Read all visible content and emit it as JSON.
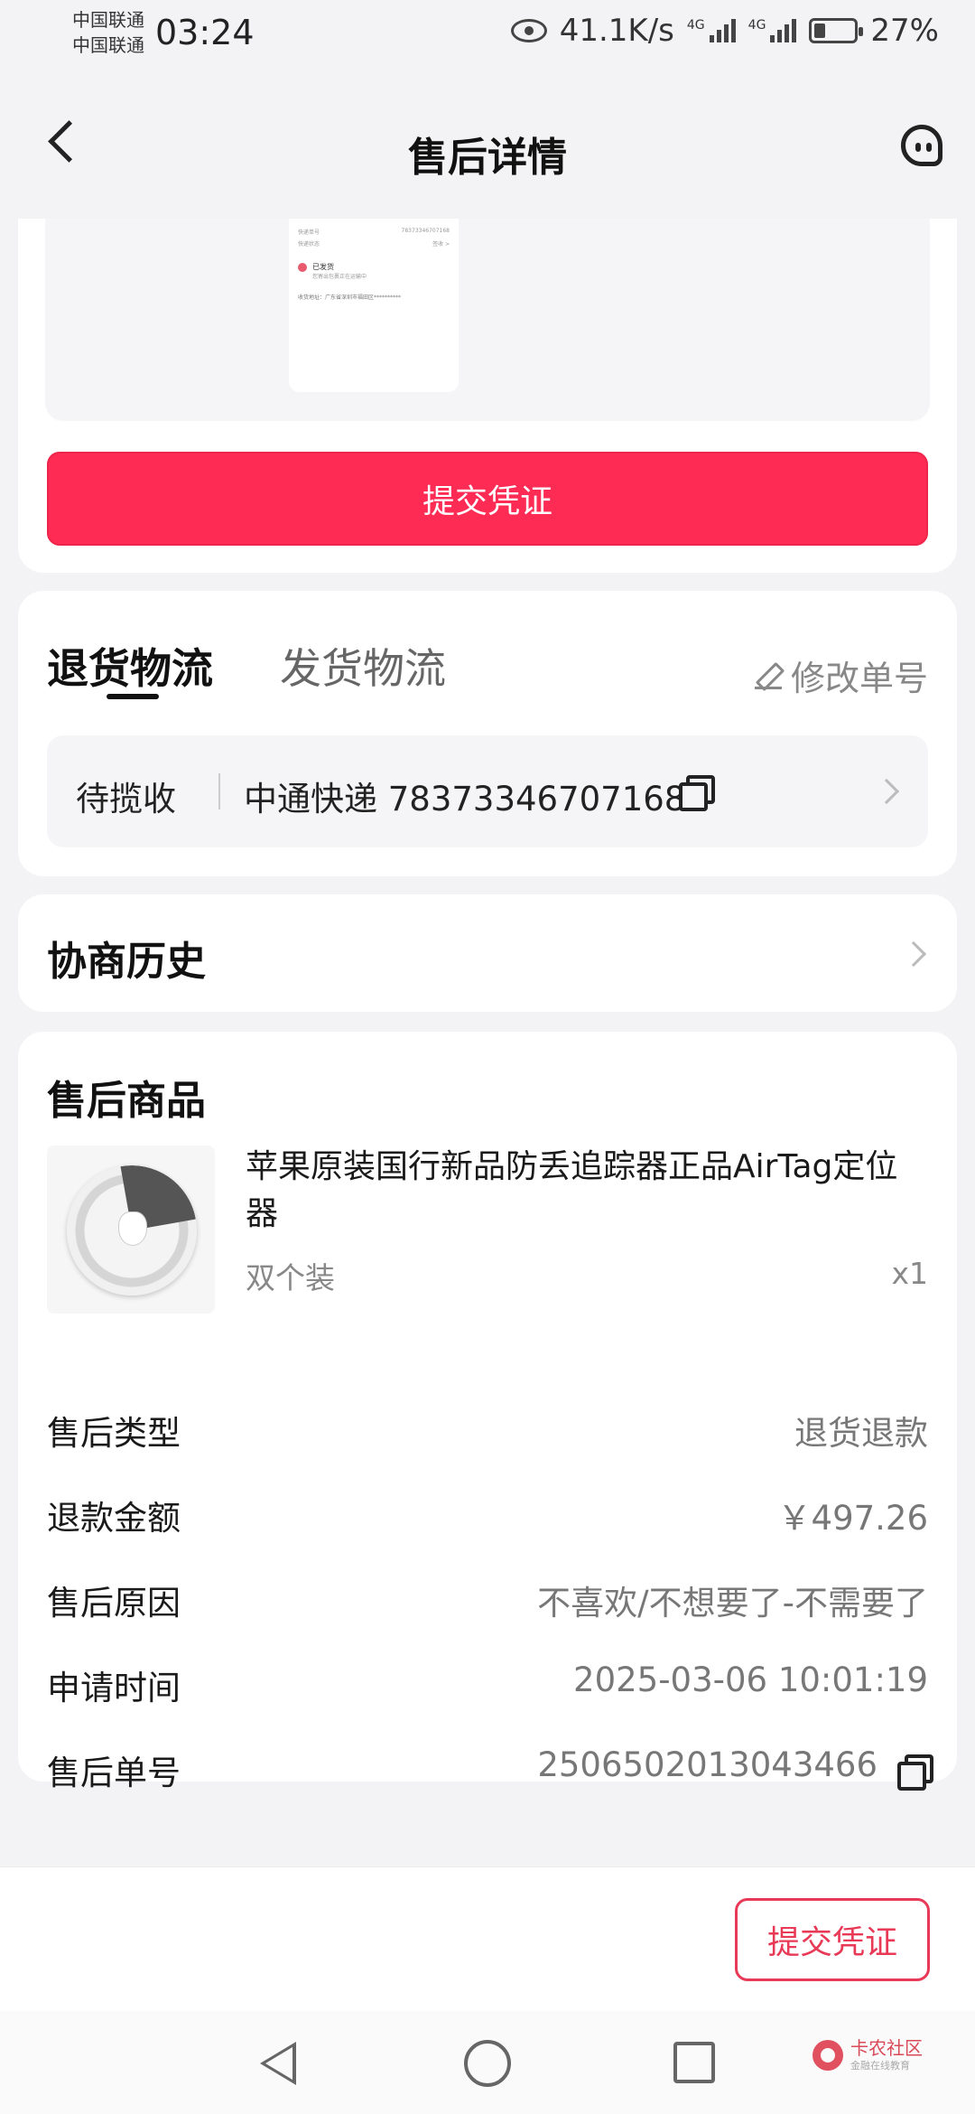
{
  "status_bar": {
    "carrier_1": "中国联通",
    "carrier_2": "中国联通",
    "time": "03:24",
    "net_speed": "41.1K/s",
    "signal_tag": "4G",
    "battery": "27%"
  },
  "header": {
    "title": "售后详情",
    "back_icon": "chevron-left-icon",
    "service_icon": "customer-service-icon"
  },
  "evidence_card": {
    "submit_label": "提交凭证",
    "thumbnail": {
      "line1_label": "快递单号",
      "line1_value": "78373346707168",
      "line2_label": "快递状态",
      "line2_value": "签收 >",
      "status": "已发货",
      "status_sub": "您寄出包裹正在运输中",
      "address": "收货地址：广东省深圳市福田区**********"
    }
  },
  "logistics": {
    "tab_return": "退货物流",
    "tab_ship": "发货物流",
    "edit_label": "修改单号",
    "status": "待揽收",
    "tracking": "中通快递 78373346707168"
  },
  "history": {
    "title": "协商历史"
  },
  "product": {
    "section_title": "售后商品",
    "name": "苹果原装国行新品防丢追踪器正品AirTag定位器",
    "spec": "双个装",
    "qty": "x1",
    "info": [
      {
        "label": "售后类型",
        "value": "退货退款"
      },
      {
        "label": "退款金额",
        "value": "￥497.26"
      },
      {
        "label": "售后原因",
        "value": "不喜欢/不想要了-不需要了"
      },
      {
        "label": "申请时间",
        "value": "2025-03-06 10:01:19"
      },
      {
        "label": "售后单号",
        "value": "2506502013043466"
      }
    ]
  },
  "bottom_bar": {
    "submit_label": "提交凭证"
  },
  "watermark": {
    "text": "卡农社区",
    "sub": "金融在线教育"
  },
  "colors": {
    "accent": "#fe2c55",
    "outline": "#e83a57",
    "background": "#f3f3f5"
  }
}
